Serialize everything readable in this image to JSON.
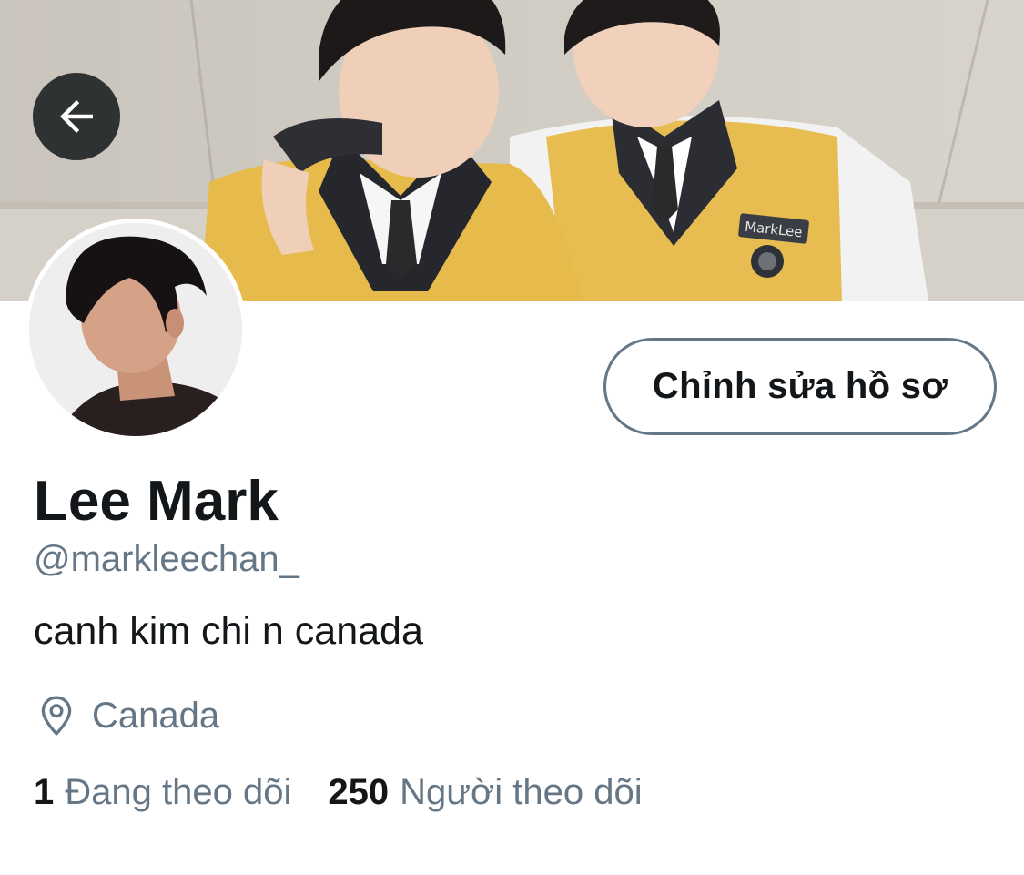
{
  "header": {
    "back_icon": "arrow-left-icon",
    "banner_badge_text": "MarkLee"
  },
  "profile": {
    "edit_button_label": "Chỉnh sửa hồ sơ",
    "name": "Lee Mark",
    "handle": "@markleechan_",
    "bio": "canh kim chi n canada",
    "location_icon": "map-pin-icon",
    "location": "Canada"
  },
  "stats": [
    {
      "count": "1",
      "label": "Đang theo dõi"
    },
    {
      "count": "250",
      "label": "Người theo dõi"
    }
  ],
  "colors": {
    "text_primary": "#14171a",
    "text_secondary": "#657786",
    "button_border": "#657786",
    "background": "#ffffff"
  }
}
